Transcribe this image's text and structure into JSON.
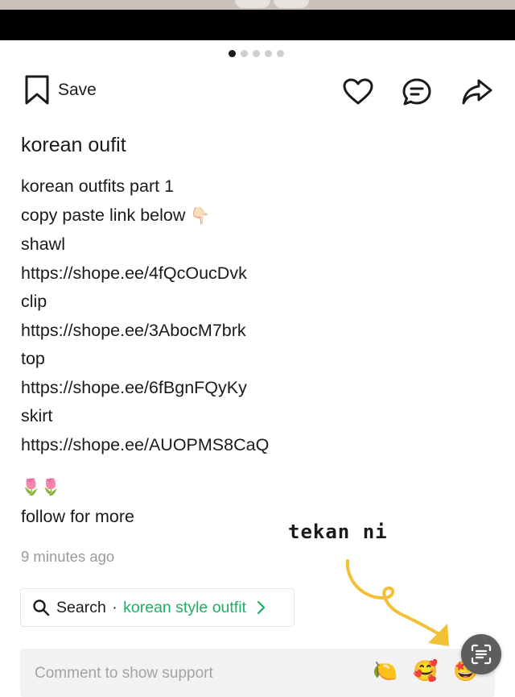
{
  "carousel": {
    "total": 5,
    "active": 0
  },
  "actions": {
    "save_label": "Save",
    "icons": [
      "bookmark-icon",
      "heart-icon",
      "comment-icon",
      "share-icon"
    ]
  },
  "post": {
    "title": "korean oufit",
    "lines": [
      "korean outfits part 1",
      "copy paste link below",
      "shawl",
      "https://shope.ee/4fQcOucDvk",
      "clip",
      "https://shope.ee/3AbocM7brk",
      "top",
      "https://shope.ee/6fBgnFQyKy",
      "skirt",
      "https://shope.ee/AUOPMS8CaQ"
    ],
    "pointing_emoji": "👇🏻",
    "flowers": "🌷🌷",
    "follow": "follow for more",
    "timestamp": "9 minutes ago"
  },
  "search": {
    "label": "Search",
    "separator": "·",
    "query": "korean style outfit",
    "accent": "#1fae66"
  },
  "annotation": {
    "text": "tekan ni",
    "arrow_color": "#f2c035"
  },
  "comment": {
    "placeholder": "Comment to show support",
    "reactions": [
      "🍋",
      "🥰",
      "🤩"
    ]
  },
  "scan_button": {
    "icon": "text-scan-icon"
  }
}
